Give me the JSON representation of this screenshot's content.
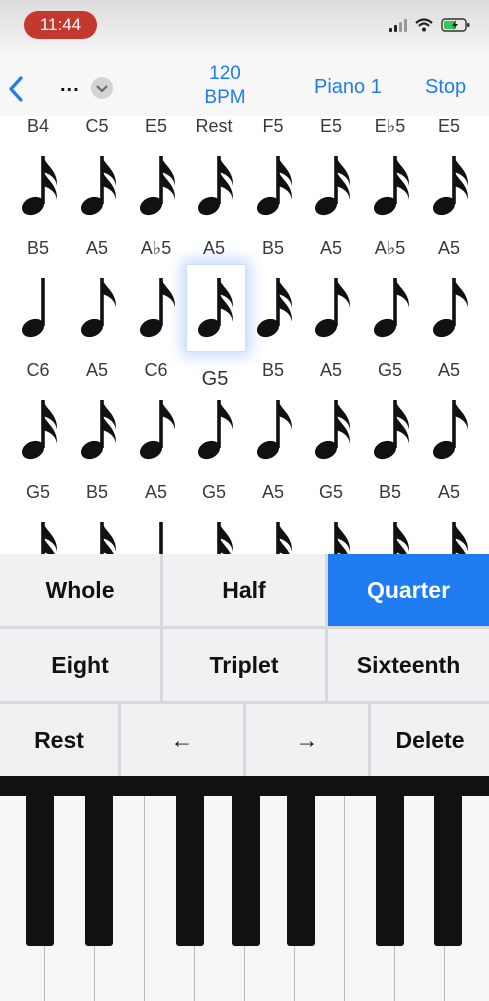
{
  "status_bar": {
    "time": "11:44"
  },
  "nav": {
    "back_icon": "chevron-left-icon",
    "menu_label": "...",
    "bpm_value": "120",
    "bpm_unit": "BPM",
    "instrument": "Piano 1",
    "stop_label": "Stop"
  },
  "grid": {
    "rows": [
      {
        "labels": [
          "B4",
          "C5",
          "E5",
          "Rest",
          "F5",
          "E5",
          "E♭5",
          "E5"
        ],
        "glyphs": [
          "sixteenth",
          "sixteenth",
          "sixteenth",
          "sixteenth",
          "sixteenth",
          "sixteenth",
          "sixteenth",
          "sixteenth"
        ]
      },
      {
        "labels": [
          "B5",
          "A5",
          "A♭5",
          "A5",
          "B5",
          "A5",
          "A♭5",
          "A5"
        ],
        "glyphs": [
          "quarter",
          "eighth",
          "eighth",
          "sixteenth",
          "sixteenth",
          "eighth",
          "eighth",
          "eighth"
        ]
      },
      {
        "labels": [
          "C6",
          "A5",
          "C6",
          "G5",
          "B5",
          "A5",
          "G5",
          "A5"
        ],
        "glyphs": [
          "sixteenth",
          "sixteenth",
          "eighth",
          "eighth",
          "eighth",
          "sixteenth",
          "sixteenth",
          "eighth"
        ]
      },
      {
        "labels": [
          "G5",
          "B5",
          "A5",
          "G5",
          "A5",
          "G5",
          "B5",
          "A5"
        ],
        "glyphs": [
          "sixteenth",
          "sixteenth",
          "quarter",
          "sixteenth",
          "sixteenth",
          "sixteenth",
          "sixteenth",
          "sixteenth"
        ]
      }
    ],
    "selected_label": "G5"
  },
  "durations": {
    "whole": "Whole",
    "half": "Half",
    "quarter": "Quarter",
    "eight": "Eight",
    "triplet": "Triplet",
    "sixteenth": "Sixteenth",
    "selected": "quarter"
  },
  "edit": {
    "rest": "Rest",
    "left_arrow": "←",
    "right_arrow": "→",
    "delete": "Delete"
  },
  "colors": {
    "accent": "#1f7cf0",
    "recording": "#c4382e"
  }
}
